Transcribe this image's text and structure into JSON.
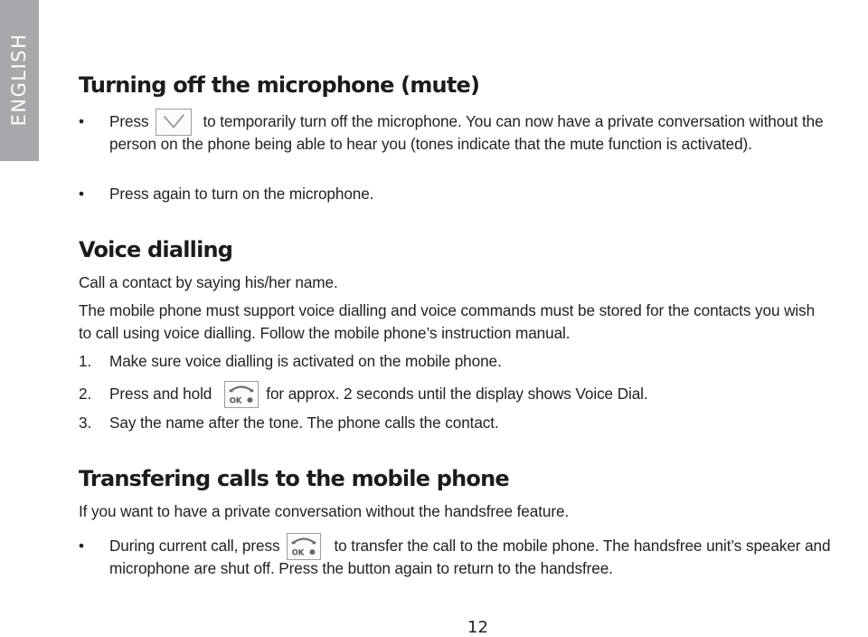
{
  "side_tab": {
    "label": "ENGLISH"
  },
  "sections": {
    "mute": {
      "heading": "Turning off the microphone (mute)",
      "bullets": [
        {
          "marker": "•",
          "before_icon": "Press",
          "icon": "mute-button-icon",
          "after_icon": "to temporarily turn off the microphone. You can now have a private conversation without the person on the phone being able to hear you (tones indicate that the mute function is activated)."
        },
        {
          "marker": "•",
          "text": "Press again to turn on the microphone."
        }
      ]
    },
    "voice_dialling": {
      "heading": "Voice dialling",
      "intro": "Call a contact by saying his/her name.",
      "description": "The mobile phone must support voice dialling and voice commands must be stored for the contacts you wish to call using voice dialling.  Follow the mobile phone’s instruction manual.",
      "steps": [
        {
          "marker": "1.",
          "text": "Make sure voice dialling is activated on the mobile phone."
        },
        {
          "marker": "2.",
          "before_icon": "Press and hold",
          "icon": "ok-call-button-icon",
          "after_icon": "for approx. 2 seconds until the display shows Voice Dial."
        },
        {
          "marker": "3.",
          "text": "Say the name after the tone.  The phone calls the contact."
        }
      ]
    },
    "transfer": {
      "heading": "Transfering calls to the mobile phone",
      "intro": "If you want to have a private conversation without the handsfree feature.",
      "bullets": [
        {
          "marker": "•",
          "before_icon": "During current call, press",
          "icon": "ok-call-button-icon",
          "after_icon": "to transfer the call to the mobile phone. The handsfree unit’s speaker and microphone are shut off. Press the button again to return to the handsfree."
        }
      ]
    }
  },
  "footer": {
    "page_number": "12"
  },
  "colors": {
    "side_tab_background": "#a7a8ab",
    "text": "#222222",
    "icon_border": "#9d9d9d"
  }
}
